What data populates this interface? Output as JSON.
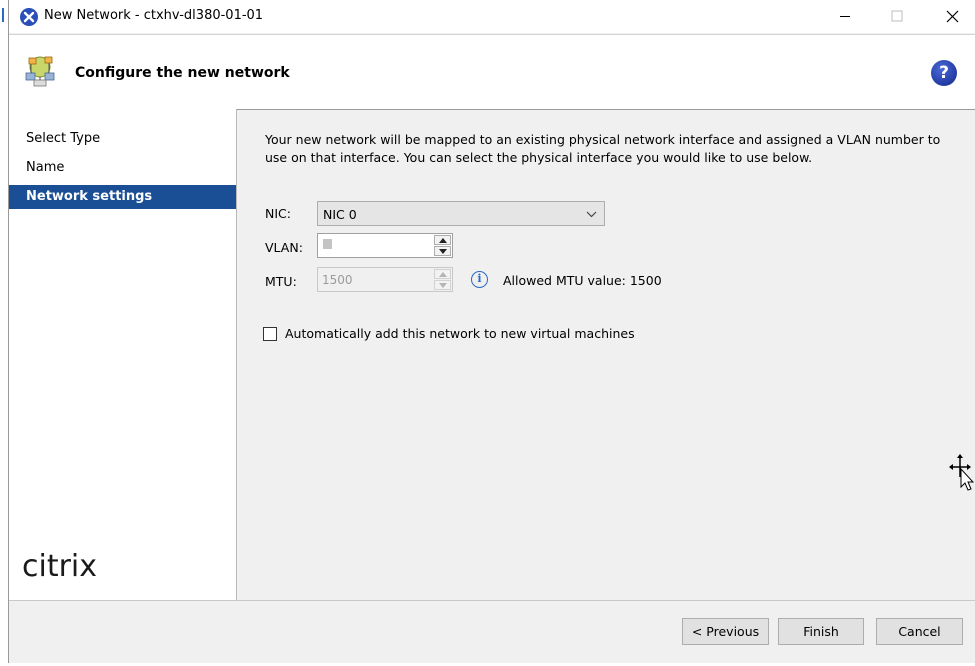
{
  "window": {
    "title": "New Network - ctxhv-dl380-01-01",
    "minimize_icon": "minimize-icon",
    "maximize_icon": "maximize-icon",
    "close_icon": "close-icon"
  },
  "header": {
    "title": "Configure the new network",
    "icon": "network-wizard-icon",
    "help_label": "?"
  },
  "sidebar": {
    "items": [
      {
        "label": "Select Type",
        "active": false
      },
      {
        "label": "Name",
        "active": false
      },
      {
        "label": "Network settings",
        "active": true
      }
    ],
    "logo_text": "citrix"
  },
  "content": {
    "description": "Your new network will be mapped to an existing physical network interface and assigned a VLAN number to use on that interface. You can select the physical interface you would like to use below.",
    "nic": {
      "label": "NIC:",
      "value": "NIC 0"
    },
    "vlan": {
      "label": "VLAN:",
      "value": ""
    },
    "mtu": {
      "label": "MTU:",
      "value": "1500",
      "info": "Allowed MTU value: 1500"
    },
    "auto_add": {
      "label": "Automatically add this network to new virtual machines",
      "checked": false
    }
  },
  "footer": {
    "previous_label": "< Previous",
    "finish_label": "Finish",
    "cancel_label": "Cancel"
  },
  "colors": {
    "selected_nav": "#1a4f96",
    "help_icon": "#1d3aa8",
    "info_icon": "#2a6ac4"
  }
}
